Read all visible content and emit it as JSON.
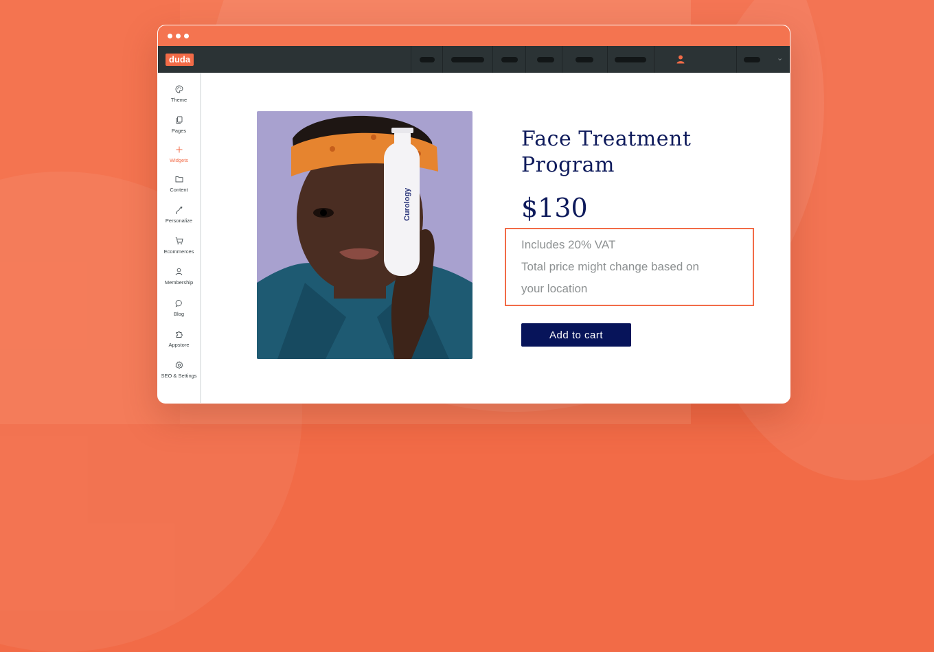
{
  "app": {
    "logo": "duda"
  },
  "sidebar": {
    "items": [
      {
        "label": "Theme",
        "icon": "palette-icon"
      },
      {
        "label": "Pages",
        "icon": "pages-icon"
      },
      {
        "label": "Widgets",
        "icon": "plus-icon",
        "active": true
      },
      {
        "label": "Content",
        "icon": "folder-icon"
      },
      {
        "label": "Personalize",
        "icon": "personalize-icon"
      },
      {
        "label": "Ecommerces",
        "icon": "cart-icon"
      },
      {
        "label": "Membership",
        "icon": "user-icon"
      },
      {
        "label": "Blog",
        "icon": "chat-icon"
      },
      {
        "label": "Appstore",
        "icon": "puzzle-icon"
      },
      {
        "label": "SEO & Settings",
        "icon": "gear-icon"
      }
    ]
  },
  "product": {
    "title": "Face Treatment Program",
    "title_line1": "Face Treatment",
    "title_line2": "Program",
    "price": "$130",
    "vat_line1": "Includes 20% VAT",
    "vat_line2": "Total price might change based on",
    "vat_line3": "your location",
    "add_to_cart": "Add to cart",
    "bottle_brand": "Curology"
  },
  "colors": {
    "accent": "#f26b47",
    "nav_bg": "#2b3335",
    "heading": "#0e1a5b",
    "button_bg": "#07145a"
  }
}
